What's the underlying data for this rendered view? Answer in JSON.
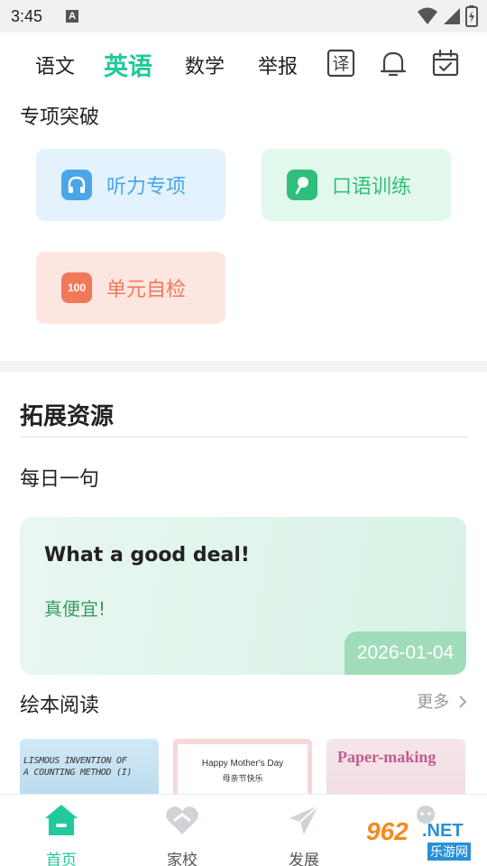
{
  "status_bar": {
    "time": "3:45",
    "notif_letter": "A",
    "icons": [
      "wifi-icon",
      "signal-icon",
      "battery-icon"
    ]
  },
  "subject_tabs": {
    "items": [
      "语文",
      "英语",
      "数学",
      "举报"
    ],
    "active_index": 1,
    "translate_glyph": "译",
    "icons": [
      "translate-icon",
      "bell-icon",
      "calendar-check-icon"
    ]
  },
  "special_practice": {
    "title": "专项突破",
    "cards": [
      {
        "label": "听力专项",
        "icon": "headphones-icon",
        "color": "#4aa6e8",
        "bg": "#e3f2fc"
      },
      {
        "label": "口语训练",
        "icon": "microphone-icon",
        "color": "#2fbf7a",
        "bg": "#e2f8ec"
      },
      {
        "label": "单元自检",
        "icon": "score-100-icon",
        "icon_text": "100",
        "color": "#f0795a",
        "bg": "#fde6df"
      }
    ]
  },
  "extended_resources": {
    "title": "拓展资源",
    "daily_sentence": {
      "title": "每日一句",
      "english": "What a good deal!",
      "chinese": "真便宜!",
      "date": "2026-01-04"
    },
    "picture_books": {
      "title": "绘本阅读",
      "more": "更多",
      "books": [
        {
          "line1": "LISMOUS INVENTION OF",
          "line2": "A COUNTING METHOD (I)"
        },
        {
          "line1": "Happy Mother's Day",
          "line2": "母亲节快乐"
        },
        {
          "line1": "Paper-making"
        }
      ]
    }
  },
  "bottom_nav": {
    "items": [
      {
        "label": "首页",
        "icon": "home-icon"
      },
      {
        "label": "家校",
        "icon": "heart-hands-icon"
      },
      {
        "label": "发展",
        "icon": "paper-plane-icon"
      },
      {
        "label": "",
        "icon": "profile-icon"
      }
    ],
    "active_index": 0
  },
  "watermark": {
    "number": "962",
    "suffix": ".NET",
    "chinese": "乐游网"
  },
  "colors": {
    "accent": "#21c99b",
    "listen": "#4aa6e8",
    "speak": "#2fbf7a",
    "unit": "#f0795a"
  }
}
